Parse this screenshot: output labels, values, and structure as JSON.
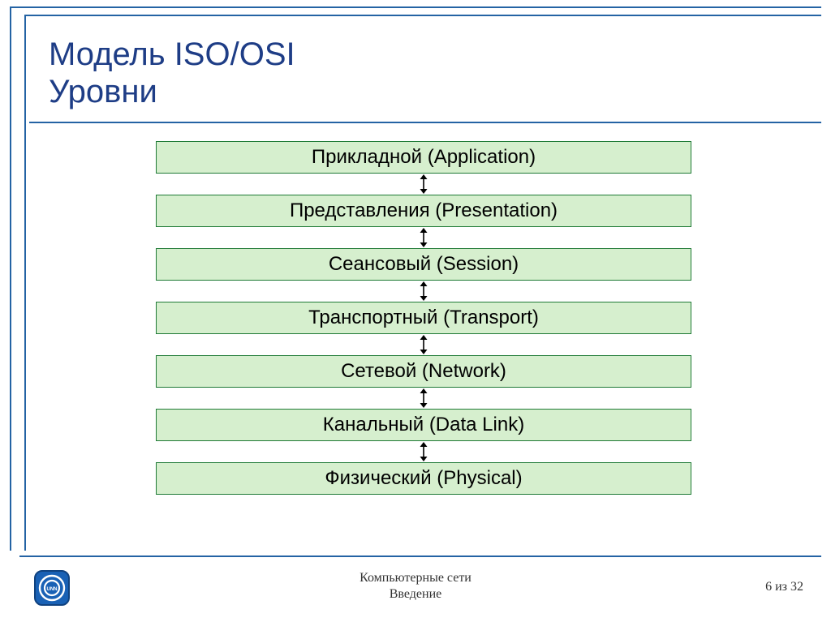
{
  "title": {
    "line1": "Модель ISO/OSI",
    "line2": "Уровни"
  },
  "layers": [
    "Прикладной (Application)",
    "Представления (Presentation)",
    "Сеансовый (Session)",
    "Транспортный (Transport)",
    "Сетевой (Network)",
    "Канальный (Data Link)",
    "Физический (Physical)"
  ],
  "footer": {
    "line1": "Компьютерные сети",
    "line2": "Введение",
    "page": "6 из 32"
  },
  "logo": {
    "text": "UNN"
  },
  "colors": {
    "frame": "#2463a4",
    "title": "#1e3d86",
    "layer_bg": "#d6efce",
    "layer_border": "#1f7a36",
    "logo_bg": "#1961b5"
  }
}
